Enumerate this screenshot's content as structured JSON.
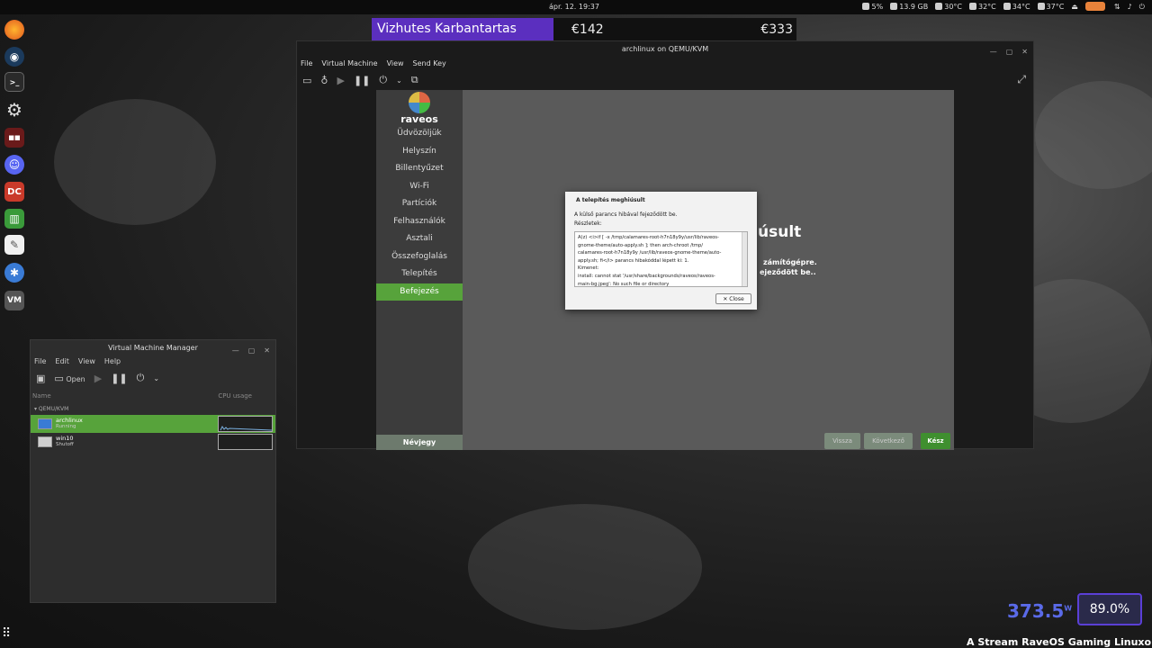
{
  "topbar": {
    "clock": "ápr. 12.  19:37",
    "cpu": "5%",
    "ram": "13.9 GB",
    "t1": "30°C",
    "t2": "32°C",
    "t3": "34°C",
    "t4": "37°C"
  },
  "banner": {
    "name": "Vizhutes Karbantartas",
    "price1": "€142",
    "price2": "€333"
  },
  "qemu": {
    "title": "archlinux on QEMU/KVM",
    "menu": [
      "File",
      "Virtual Machine",
      "View",
      "Send Key"
    ]
  },
  "installer": {
    "logo": "raveos",
    "steps": [
      "Üdvözöljük",
      "Helyszín",
      "Billentyűzet",
      "Wi-Fi",
      "Partíciók",
      "Felhasználók",
      "Asztali",
      "Összefoglalás",
      "Telepítés",
      "Befejezés"
    ],
    "active_step": 9,
    "about": "Névjegy",
    "bg_title": "úsult",
    "bg_line1": "zámítógépre.",
    "bg_line2": "ejeződött be..",
    "back": "Vissza",
    "next": "Következő",
    "done": "Kész"
  },
  "dialog": {
    "title": "A telepítés meghiúsult",
    "message": "A külső parancs hibával fejeződött be.",
    "details_label": "Részletek:",
    "details": [
      "A(z) <i>if [ -x /tmp/calamares-root-h7n18y9y/usr/lib/raveos-",
      "gnome-theme/auto-apply.sh ]; then arch-chroot /tmp/",
      "calamares-root-h7n18y9y /usr/lib/raveos-gnome-theme/auto-",
      "apply.sh; fi</i> parancs hibakóddal lépett ki: 1.",
      "Kimenet:",
      "install: cannot stat '/usr/share/backgrounds/raveos/raveos-",
      "main-bg.jpeg': No such file or directory"
    ],
    "close": "Close"
  },
  "vmm": {
    "title": "Virtual Machine Manager",
    "menu": [
      "File",
      "Edit",
      "View",
      "Help"
    ],
    "open": "Open",
    "col_name": "Name",
    "col_cpu": "CPU usage",
    "group": "QEMU/KVM",
    "vms": [
      {
        "name": "archlinux",
        "state": "Running"
      },
      {
        "name": "win10",
        "state": "Shutoff"
      }
    ]
  },
  "overlay": {
    "watts": "373.5",
    "watts_unit": "W",
    "percent": "89.0%",
    "stream": "A Stream RaveOS Gaming Linuxon fut"
  },
  "colors": {
    "accent_green": "#57a33b",
    "banner_purple": "#5b2fbf"
  }
}
